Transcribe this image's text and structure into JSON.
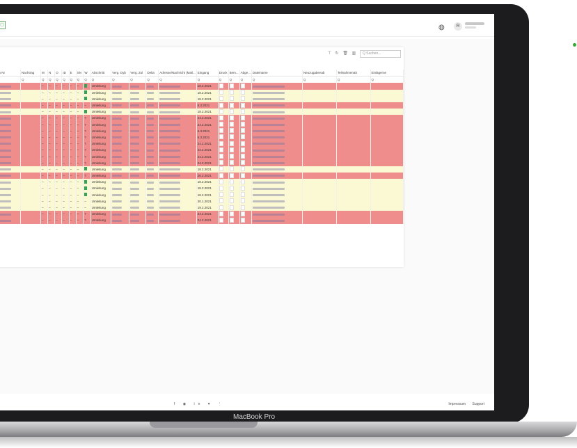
{
  "device": {
    "label": "MacBook Pro"
  },
  "header": {
    "avatar_initial": "R",
    "globe_icon": "globe-icon"
  },
  "table": {
    "columns": [
      "Dyb Nr",
      "Nachtrag",
      "M",
      "N",
      "O",
      "ID",
      "E",
      "SN",
      "W",
      "Abschnitt",
      "Verg. Dyb",
      "Verg. Zul",
      "Delta",
      "Adresse/Nachricht (Mail...",
      "Eingang",
      "Druck",
      "Bem...",
      "Abge...",
      "Dateiname",
      "Neuzugabenab",
      "Teilnahmenab",
      "Einlagerne"
    ],
    "filter_glyph": "Q",
    "rows": [
      {
        "tone": "red",
        "status": "green",
        "abschnitt": "Umleitung",
        "eingang": "18.2.2021"
      },
      {
        "tone": "yellow",
        "status": "green",
        "abschnitt": "Umleitung",
        "eingang": "18.2.2021"
      },
      {
        "tone": "yellow",
        "status": "green",
        "abschnitt": "Umleitung",
        "eingang": "18.2.2021"
      },
      {
        "tone": "red",
        "status": "dash",
        "abschnitt": "Umleitung",
        "eingang": "5.3.2021"
      },
      {
        "tone": "yellow",
        "status": "green",
        "abschnitt": "Umleitung",
        "eingang": "18.2.2021"
      },
      {
        "tone": "red",
        "status": "question",
        "abschnitt": "Umleitung",
        "eingang": "24.2.2021"
      },
      {
        "tone": "red",
        "status": "question",
        "abschnitt": "Umleitung",
        "eingang": "24.2.2021"
      },
      {
        "tone": "red",
        "status": "question",
        "abschnitt": "Umleitung",
        "eingang": "5.3.2021"
      },
      {
        "tone": "red",
        "status": "question",
        "abschnitt": "Umleitung",
        "eingang": "5.3.2021"
      },
      {
        "tone": "red",
        "status": "question",
        "abschnitt": "Umleitung",
        "eingang": "24.2.2021"
      },
      {
        "tone": "red",
        "status": "question",
        "abschnitt": "Umleitung",
        "eingang": "24.2.2021"
      },
      {
        "tone": "red",
        "status": "question",
        "abschnitt": "Umleitung",
        "eingang": "24.2.2021"
      },
      {
        "tone": "red",
        "status": "question",
        "abschnitt": "Umleitung",
        "eingang": "24.2.2021"
      },
      {
        "tone": "yellow",
        "status": "green",
        "abschnitt": "Umleitung",
        "eingang": "18.2.2021"
      },
      {
        "tone": "red",
        "status": "question",
        "abschnitt": "Umleitung",
        "eingang": "26.2.2021"
      },
      {
        "tone": "yellow",
        "status": "green",
        "abschnitt": "Umleitung",
        "eingang": "18.2.2021"
      },
      {
        "tone": "yellow",
        "status": "green",
        "abschnitt": "Umleitung",
        "eingang": "18.2.2021"
      },
      {
        "tone": "yellow",
        "status": "green",
        "abschnitt": "Umleitung",
        "eingang": "18.2.2021"
      },
      {
        "tone": "yellow",
        "status": "dash",
        "abschnitt": "Umleitung",
        "eingang": "20.1.2021"
      },
      {
        "tone": "yellow",
        "status": "dash",
        "abschnitt": "Umleitung",
        "eingang": "19.2.2021"
      },
      {
        "tone": "red",
        "status": "question",
        "abschnitt": "Umleitung",
        "eingang": "24.2.2021"
      },
      {
        "tone": "red",
        "status": "question",
        "abschnitt": "Umleitung",
        "eingang": "24.2.2021"
      }
    ]
  },
  "footer": {
    "social": "f ◉ in ♥ ⋮",
    "impressum": "Impressum",
    "support": "Support"
  },
  "colors": {
    "red_row": "#ef8c8c",
    "yellow_row": "#fbf8d4",
    "accent": "#35a35a"
  }
}
